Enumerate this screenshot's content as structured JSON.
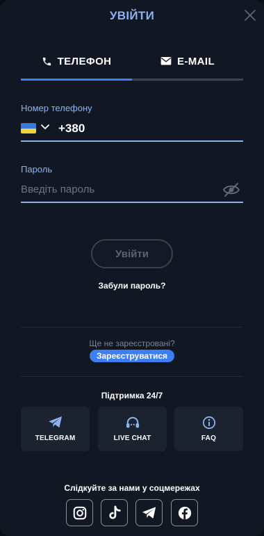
{
  "header": {
    "title": "УВІЙТИ",
    "close_icon": "close-icon"
  },
  "tabs": [
    {
      "label": "ТЕЛЕФОН",
      "icon": "phone-icon",
      "active": true
    },
    {
      "label": "E-MAIL",
      "icon": "envelope-icon",
      "active": false
    }
  ],
  "phone": {
    "label": "Номер телефону",
    "country_flag": "ukraine-flag",
    "value": "+380"
  },
  "password": {
    "label": "Пароль",
    "placeholder": "Введіть пароль",
    "icon": "eye-hidden-icon"
  },
  "login_button": "Увійти",
  "forgot_password": "Забули пароль?",
  "register": {
    "question": "Ще не зареєстровані?",
    "button": "Зареєструватися"
  },
  "support": {
    "title": "Підтримка 24/7",
    "items": [
      {
        "label": "TELEGRAM",
        "icon": "telegram-icon"
      },
      {
        "label": "LIVE CHAT",
        "icon": "headset-icon"
      },
      {
        "label": "FAQ",
        "icon": "info-icon"
      }
    ]
  },
  "social": {
    "title": "Слідкуйте за нами у соцмережах",
    "items": [
      {
        "name": "instagram-icon"
      },
      {
        "name": "tiktok-icon"
      },
      {
        "name": "telegram-icon"
      },
      {
        "name": "facebook-icon"
      }
    ]
  },
  "colors": {
    "accent": "#3d7ff0",
    "label": "#8db2ee",
    "background": "#111823",
    "card": "#1b2230"
  }
}
